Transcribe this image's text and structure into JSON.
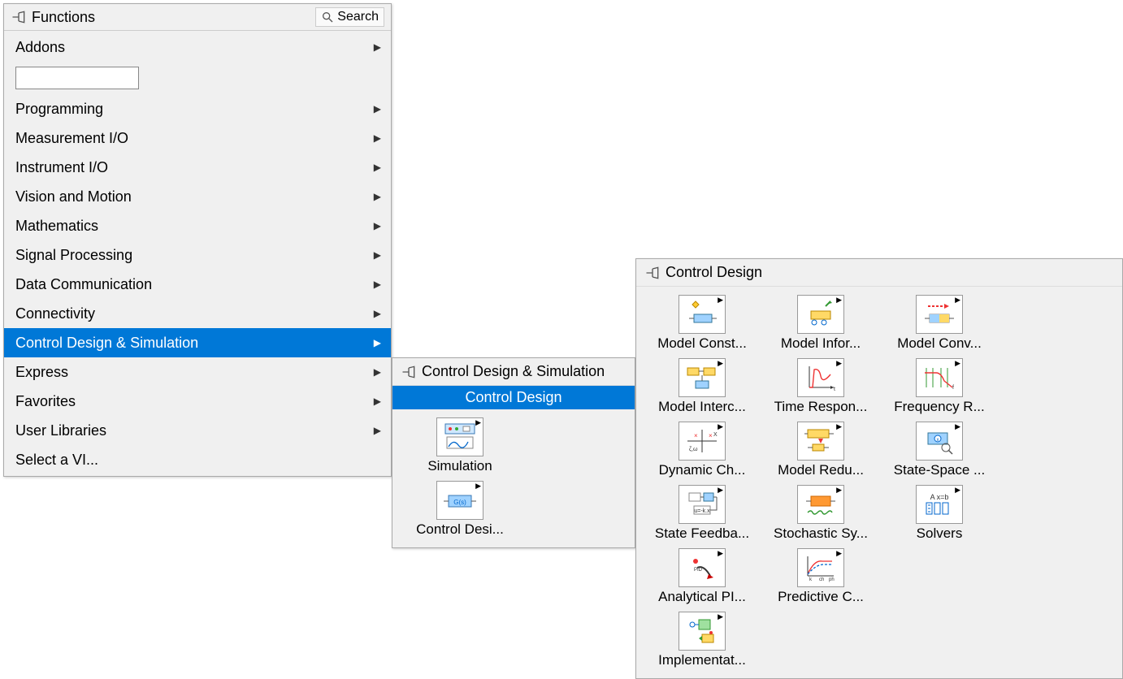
{
  "mainPalette": {
    "title": "Functions",
    "searchLabel": "Search",
    "inputValue": "",
    "items": [
      {
        "label": "Addons",
        "arrow": true
      },
      {
        "label": "Programming",
        "arrow": true
      },
      {
        "label": "Measurement I/O",
        "arrow": true
      },
      {
        "label": "Instrument I/O",
        "arrow": true
      },
      {
        "label": "Vision and Motion",
        "arrow": true
      },
      {
        "label": "Mathematics",
        "arrow": true
      },
      {
        "label": "Signal Processing",
        "arrow": true
      },
      {
        "label": "Data Communication",
        "arrow": true
      },
      {
        "label": "Connectivity",
        "arrow": true
      },
      {
        "label": "Control Design & Simulation",
        "arrow": true,
        "highlighted": true
      },
      {
        "label": "Express",
        "arrow": true
      },
      {
        "label": "Favorites",
        "arrow": true
      },
      {
        "label": "User Libraries",
        "arrow": true
      },
      {
        "label": "Select a VI...",
        "arrow": false
      }
    ]
  },
  "subPalette1": {
    "title": "Control Design & Simulation",
    "highlightedTitle": "Control Design",
    "icons": [
      {
        "label": "Simulation"
      },
      {
        "label": "Control Desi..."
      }
    ]
  },
  "subPalette2": {
    "title": "Control Design",
    "icons": [
      {
        "label": "Model Const..."
      },
      {
        "label": "Model Infor..."
      },
      {
        "label": "Model Conv..."
      },
      {
        "label": "Model Interc..."
      },
      {
        "label": "Time Respon..."
      },
      {
        "label": "Frequency R..."
      },
      {
        "label": "Dynamic Ch..."
      },
      {
        "label": "Model Redu..."
      },
      {
        "label": "State-Space ..."
      },
      {
        "label": "State Feedba..."
      },
      {
        "label": "Stochastic Sy..."
      },
      {
        "label": "Solvers"
      },
      {
        "label": "Analytical PI..."
      },
      {
        "label": "Predictive C..."
      },
      {
        "label": ""
      },
      {
        "label": "Implementat..."
      }
    ]
  }
}
